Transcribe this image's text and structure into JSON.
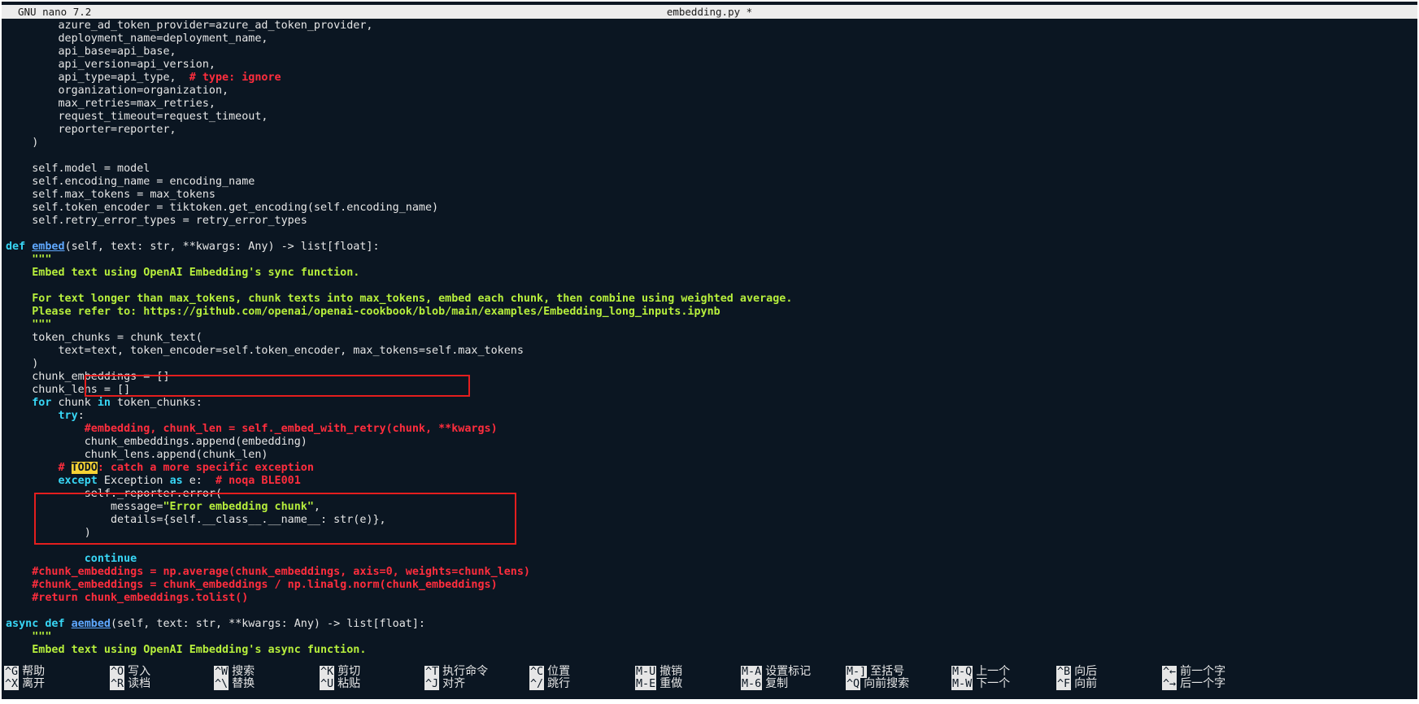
{
  "window": {
    "app_title": "GNU nano 7.2",
    "file_title": "embedding.py *"
  },
  "colors": {
    "background": "#0b1622",
    "keyword": "#38d6f5",
    "function_name": "#5fa8ff",
    "docstring": "#b7ef3c",
    "comment": "#ff2d3d",
    "todo_highlight": "#f6d234",
    "annotation_box": "#e41e1e"
  },
  "code_lines": [
    [
      {
        "t": "        azure_ad_token_provider=azure_ad_token_provider,",
        "c": "plain"
      }
    ],
    [
      {
        "t": "        deployment_name=deployment_name,",
        "c": "plain"
      }
    ],
    [
      {
        "t": "        api_base=api_base,",
        "c": "plain"
      }
    ],
    [
      {
        "t": "        api_version=api_version,",
        "c": "plain"
      }
    ],
    [
      {
        "t": "        api_type=api_type,  ",
        "c": "plain"
      },
      {
        "t": "# type: ignore",
        "c": "cmt"
      }
    ],
    [
      {
        "t": "        organization=organization,",
        "c": "plain"
      }
    ],
    [
      {
        "t": "        max_retries=max_retries,",
        "c": "plain"
      }
    ],
    [
      {
        "t": "        request_timeout=request_timeout,",
        "c": "plain"
      }
    ],
    [
      {
        "t": "        reporter=reporter,",
        "c": "plain"
      }
    ],
    [
      {
        "t": "    )",
        "c": "plain"
      }
    ],
    [
      {
        "t": "",
        "c": "plain"
      }
    ],
    [
      {
        "t": "    self.model = model",
        "c": "plain"
      }
    ],
    [
      {
        "t": "    self.encoding_name = encoding_name",
        "c": "plain"
      }
    ],
    [
      {
        "t": "    self.max_tokens = max_tokens",
        "c": "plain"
      }
    ],
    [
      {
        "t": "    self.token_encoder = tiktoken.get_encoding(self.encoding_name)",
        "c": "plain"
      }
    ],
    [
      {
        "t": "    self.retry_error_types = retry_error_types",
        "c": "plain"
      }
    ],
    [
      {
        "t": "",
        "c": "plain"
      }
    ],
    [
      {
        "t": "def ",
        "c": "kw"
      },
      {
        "t": "embed",
        "c": "fn"
      },
      {
        "t": "(self, text: str, **kwargs: Any) -> list[float]:",
        "c": "plain"
      }
    ],
    [
      {
        "t": "    \"\"\"",
        "c": "doc"
      }
    ],
    [
      {
        "t": "    Embed text using OpenAI Embedding's sync function.",
        "c": "doc"
      }
    ],
    [
      {
        "t": "",
        "c": "plain"
      }
    ],
    [
      {
        "t": "    For text longer than max_tokens, chunk texts into max_tokens, embed each chunk, then combine using weighted average.",
        "c": "doc"
      }
    ],
    [
      {
        "t": "    Please refer to: https://github.com/openai/openai-cookbook/blob/main/examples/Embedding_long_inputs.ipynb",
        "c": "doc"
      }
    ],
    [
      {
        "t": "    \"\"\"",
        "c": "doc"
      }
    ],
    [
      {
        "t": "    token_chunks = chunk_text(",
        "c": "plain"
      }
    ],
    [
      {
        "t": "        text=text, token_encoder=self.token_encoder, max_tokens=self.max_tokens",
        "c": "plain"
      }
    ],
    [
      {
        "t": "    )",
        "c": "plain"
      }
    ],
    [
      {
        "t": "    chunk_embeddings = []",
        "c": "plain"
      }
    ],
    [
      {
        "t": "    chunk_lens = []",
        "c": "plain"
      }
    ],
    [
      {
        "t": "    ",
        "c": "plain"
      },
      {
        "t": "for",
        "c": "kw"
      },
      {
        "t": " chunk ",
        "c": "plain"
      },
      {
        "t": "in",
        "c": "kw"
      },
      {
        "t": " token_chunks:",
        "c": "plain"
      }
    ],
    [
      {
        "t": "        ",
        "c": "plain"
      },
      {
        "t": "try",
        "c": "kw"
      },
      {
        "t": ":",
        "c": "plain"
      }
    ],
    [
      {
        "t": "            #embedding, chunk_len = self._embed_with_retry(chunk, **kwargs)",
        "c": "cmt"
      }
    ],
    [
      {
        "t": "            chunk_embeddings.append(embedding)",
        "c": "plain"
      }
    ],
    [
      {
        "t": "            chunk_lens.append(chunk_len)",
        "c": "plain"
      }
    ],
    [
      {
        "t": "        # ",
        "c": "cmt"
      },
      {
        "t": "TODO",
        "c": "todo"
      },
      {
        "t": ": catch a more specific exception",
        "c": "cmt"
      }
    ],
    [
      {
        "t": "        ",
        "c": "plain"
      },
      {
        "t": "except",
        "c": "kw"
      },
      {
        "t": " Exception ",
        "c": "plain"
      },
      {
        "t": "as",
        "c": "kw"
      },
      {
        "t": " e:  ",
        "c": "plain"
      },
      {
        "t": "# noqa BLE001",
        "c": "cmt"
      }
    ],
    [
      {
        "t": "            self._reporter.error(",
        "c": "plain"
      }
    ],
    [
      {
        "t": "                message=",
        "c": "plain"
      },
      {
        "t": "\"Error embedding chunk\"",
        "c": "str"
      },
      {
        "t": ",",
        "c": "plain"
      }
    ],
    [
      {
        "t": "                details={self.__class__.__name__: str(e)},",
        "c": "plain"
      }
    ],
    [
      {
        "t": "            )",
        "c": "plain"
      }
    ],
    [
      {
        "t": "",
        "c": "plain"
      }
    ],
    [
      {
        "t": "            ",
        "c": "plain"
      },
      {
        "t": "continue",
        "c": "kw"
      }
    ],
    [
      {
        "t": "    #chunk_embeddings = np.average(chunk_embeddings, axis=0, weights=chunk_lens)",
        "c": "cmt"
      }
    ],
    [
      {
        "t": "    #chunk_embeddings = chunk_embeddings / np.linalg.norm(chunk_embeddings)",
        "c": "cmt"
      }
    ],
    [
      {
        "t": "    #return chunk_embeddings.tolist()",
        "c": "cmt"
      }
    ],
    [
      {
        "t": "",
        "c": "plain"
      }
    ],
    [
      {
        "t": "async def ",
        "c": "kw"
      },
      {
        "t": "aembed",
        "c": "fn"
      },
      {
        "t": "(self, text: str, **kwargs: Any) -> list[float]:",
        "c": "plain"
      }
    ],
    [
      {
        "t": "    \"\"\"",
        "c": "doc"
      }
    ],
    [
      {
        "t": "    Embed text using OpenAI Embedding's async function.",
        "c": "doc"
      }
    ]
  ],
  "shortcuts": [
    [
      {
        "key": "^G",
        "label": "帮助"
      },
      {
        "key": "^X",
        "label": "离开"
      }
    ],
    [
      {
        "key": "^O",
        "label": "写入"
      },
      {
        "key": "^R",
        "label": "读档"
      }
    ],
    [
      {
        "key": "^W",
        "label": "搜索"
      },
      {
        "key": "^\\",
        "label": "替换"
      }
    ],
    [
      {
        "key": "^K",
        "label": "剪切"
      },
      {
        "key": "^U",
        "label": "粘贴"
      }
    ],
    [
      {
        "key": "^T",
        "label": "执行命令"
      },
      {
        "key": "^J",
        "label": "对齐"
      }
    ],
    [
      {
        "key": "^C",
        "label": "位置"
      },
      {
        "key": "^/",
        "label": "跳行"
      }
    ],
    [
      {
        "key": "M-U",
        "label": "撤销"
      },
      {
        "key": "M-E",
        "label": "重做"
      }
    ],
    [
      {
        "key": "M-A",
        "label": "设置标记"
      },
      {
        "key": "M-6",
        "label": "复制"
      }
    ],
    [
      {
        "key": "M-]",
        "label": "至括号"
      },
      {
        "key": "^Q",
        "label": "向前搜索"
      }
    ],
    [
      {
        "key": "M-Q",
        "label": "上一个"
      },
      {
        "key": "M-W",
        "label": "下一个"
      }
    ],
    [
      {
        "key": "^B",
        "label": "向后"
      },
      {
        "key": "^F",
        "label": "向前"
      }
    ],
    [
      {
        "key": "^←",
        "label": "前一个字"
      },
      {
        "key": "^→",
        "label": "后一个字"
      }
    ]
  ]
}
